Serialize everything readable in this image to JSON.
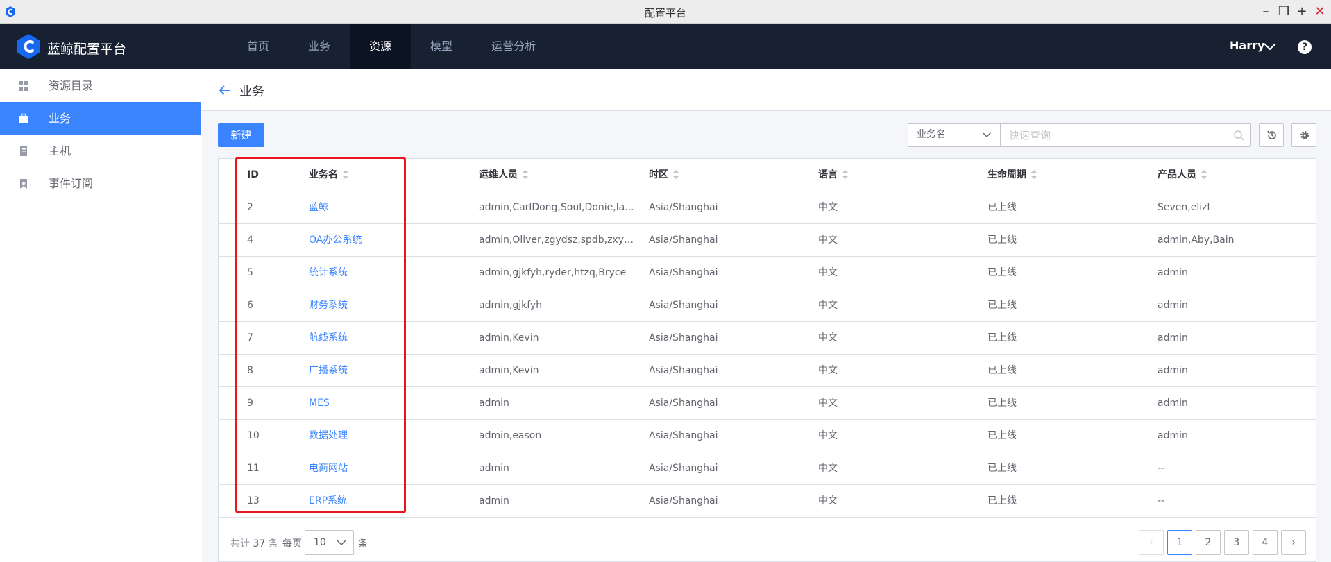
{
  "window": {
    "title": "配置平台"
  },
  "topnav": {
    "brand": "蓝鲸配置平台",
    "items": [
      "首页",
      "业务",
      "资源",
      "模型",
      "运营分析"
    ],
    "active_index": 2,
    "user": "Harry",
    "help": "?"
  },
  "sidebar": {
    "items": [
      "资源目录",
      "业务",
      "主机",
      "事件订阅"
    ],
    "icons": [
      "grid-icon",
      "briefcase-icon",
      "host-icon",
      "bookmark-icon"
    ],
    "active_index": 1
  },
  "breadcrumb": {
    "title": "业务"
  },
  "toolbar": {
    "new_label": "新建",
    "filter_field": "业务名",
    "search_placeholder": "快速查询"
  },
  "table": {
    "columns": [
      "ID",
      "业务名",
      "运维人员",
      "时区",
      "语言",
      "生命周期",
      "产品人员"
    ],
    "rows": [
      [
        "2",
        "蓝鲸",
        "admin,CarlDong,Soul,Donie,la...",
        "Asia/Shanghai",
        "中文",
        "已上线",
        "Seven,elizl"
      ],
      [
        "4",
        "OA办公系统",
        "admin,Oliver,zgydsz,spdb,zxyh...",
        "Asia/Shanghai",
        "中文",
        "已上线",
        "admin,Aby,Bain"
      ],
      [
        "5",
        "统计系统",
        "admin,gjkfyh,ryder,htzq,Bryce",
        "Asia/Shanghai",
        "中文",
        "已上线",
        "admin"
      ],
      [
        "6",
        "财务系统",
        "admin,gjkfyh",
        "Asia/Shanghai",
        "中文",
        "已上线",
        "admin"
      ],
      [
        "7",
        "航线系统",
        "admin,Kevin",
        "Asia/Shanghai",
        "中文",
        "已上线",
        "admin"
      ],
      [
        "8",
        "广播系统",
        "admin,Kevin",
        "Asia/Shanghai",
        "中文",
        "已上线",
        "admin"
      ],
      [
        "9",
        "MES",
        "admin",
        "Asia/Shanghai",
        "中文",
        "已上线",
        "admin"
      ],
      [
        "10",
        "数据处理",
        "admin,eason",
        "Asia/Shanghai",
        "中文",
        "已上线",
        "admin"
      ],
      [
        "11",
        "电商网站",
        "admin",
        "Asia/Shanghai",
        "中文",
        "已上线",
        "--"
      ],
      [
        "13",
        "ERP系统",
        "admin",
        "Asia/Shanghai",
        "中文",
        "已上线",
        "--"
      ]
    ]
  },
  "pagination": {
    "total_prefix": "共计",
    "total": "37",
    "total_suffix": "条",
    "per_page_label": "每页",
    "per_page": "10",
    "per_page_unit": "条",
    "pages": [
      "1",
      "2",
      "3",
      "4"
    ],
    "current": "1",
    "prev": "‹",
    "next": "›"
  },
  "colors": {
    "accent": "#3a84ff",
    "nav_bg": "#182132",
    "highlight": "#e8151c"
  }
}
